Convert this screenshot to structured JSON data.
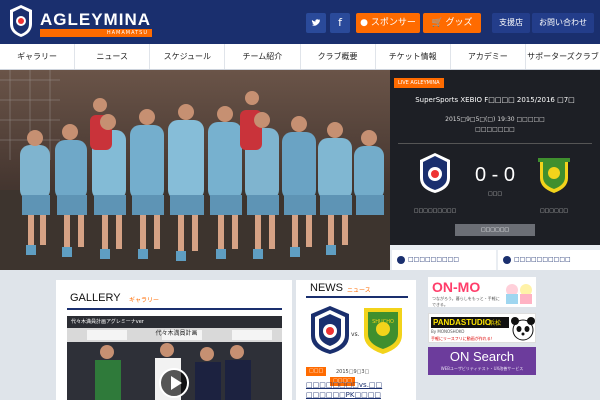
{
  "brand": {
    "name": "AGLEYMINA",
    "tagline": "HAMAMATSU",
    "colors": {
      "navy": "#1a2f6e",
      "orange": "#ff6b00"
    }
  },
  "header": {
    "twitter_icon": "twitter-bird-icon",
    "facebook_label": "f",
    "sponsor_label": "スポンサー",
    "goods_label": "グッズ",
    "support_label": "支援店",
    "contact_label": "お問い合わせ"
  },
  "nav": {
    "items": [
      {
        "label": "ギャラリー"
      },
      {
        "label": "ニュース"
      },
      {
        "label": "スケジュール"
      },
      {
        "label": "チーム紹介"
      },
      {
        "label": "クラブ概要"
      },
      {
        "label": "チケット情報"
      },
      {
        "label": "アカデミー"
      },
      {
        "label": "サポーターズクラブ"
      }
    ]
  },
  "live": {
    "tag": "LIVE AGLEYMINA",
    "title": "SuperSports XEBIO F□□□□ 2015/2016 □7□",
    "date": "2015□9□5□(□) 19:30 □□□□□",
    "venue": "□□□□□□□",
    "score": "0 - 0",
    "score_label": "□□□",
    "home_team": "□□□□□□□□□",
    "away_team": "□□□□□□",
    "button": "□□□□□□"
  },
  "mini_links": [
    {
      "label": "□□□□□□□□□"
    },
    {
      "label": "□□□□□□□□□□"
    }
  ],
  "gallery": {
    "title": "GALLERY",
    "sub": "ギャラリー",
    "video_title": "代々木満員計画アグレミーナver",
    "banner_text": "代々木満員計画"
  },
  "news": {
    "title": "NEWS",
    "sub": "ニュース",
    "vs": "vs.",
    "badge_text": "SHUCHO",
    "date": "2015□9□3□",
    "tags": [
      "□□□",
      "□□□□"
    ],
    "headline": "□□□□□□□□vs.□□ □□□□□□PK□□□□"
  },
  "ads": {
    "onmo_title": "ON-MO",
    "onmo_sub": "つながろう。暮らしをもっと・手軽にできる。",
    "panda_title": "PANDASTUDIO",
    "panda_tag": "浜松",
    "panda_sub": "手軽にリースフリに動画が作れる！",
    "panda_by": "By MONOSHOKO",
    "onsearch_title": "ON Search",
    "onsearch_sub": "WEBユーザビリティテスト・UX改善サービス"
  }
}
